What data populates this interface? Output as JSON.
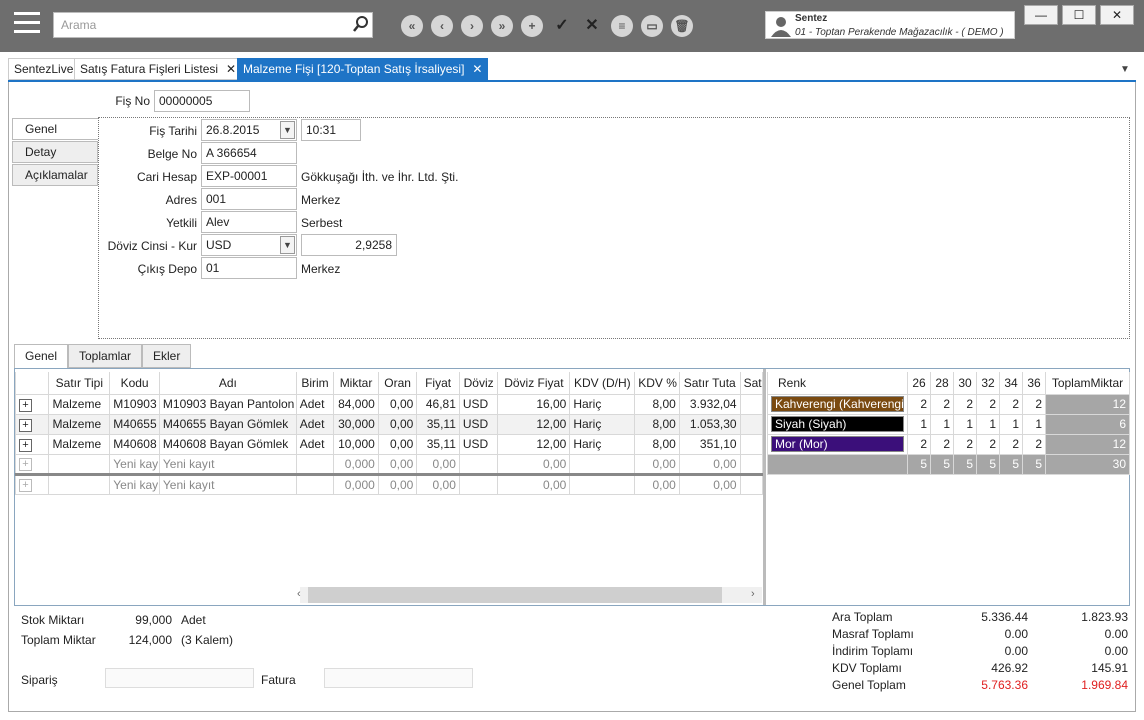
{
  "search": {
    "placeholder": "Arama"
  },
  "user": {
    "name": "Sentez",
    "company": "01 - Toptan Perakende Mağazacılık - ( DEMO )"
  },
  "tabs": [
    {
      "label": "SentezLive"
    },
    {
      "label": "Satış Fatura Fişleri Listesi"
    },
    {
      "label": "Malzeme Fişi  [120-Toptan Satış İrsaliyesi]"
    }
  ],
  "header": {
    "fis_no_label": "Fiş No",
    "fis_no": "00000005"
  },
  "side_tabs": [
    "Genel",
    "Detay",
    "Açıklamalar"
  ],
  "form": {
    "fis_tarihi_label": "Fiş Tarihi",
    "fis_tarihi": "26.8.2015",
    "saat": "10:31",
    "belge_no_label": "Belge No",
    "belge_no": "A 366654",
    "cari_label": "Cari Hesap",
    "cari": "EXP-00001",
    "cari_name": "Gökkuşağı İth. ve İhr. Ltd. Şti.",
    "adres_label": "Adres",
    "adres": "001",
    "adres_name": "Merkez",
    "yetkili_label": "Yetkili",
    "yetkili": "Alev",
    "yetkili_name": "Serbest",
    "doviz_label": "Döviz Cinsi - Kur",
    "doviz": "USD",
    "kur": "2,9258",
    "depo_label": "Çıkış Depo",
    "depo": "01",
    "depo_name": "Merkez"
  },
  "bottom_tabs": [
    "Genel",
    "Toplamlar",
    "Ekler"
  ],
  "grid": {
    "columns": [
      "Satır Tipi",
      "Kodu",
      "Adı",
      "Birim",
      "Miktar",
      "Oran",
      "Fiyat",
      "Döviz",
      "Döviz Fiyat",
      "KDV (D/H)",
      "KDV %",
      "Satır Tuta",
      "Satı"
    ],
    "rows": [
      [
        "Malzeme",
        "M10903",
        "M10903 Bayan Pantolon",
        "Adet",
        "84,000",
        "0,00",
        "46,81",
        "USD",
        "16,00",
        "Hariç",
        "8,00",
        "3.932,04"
      ],
      [
        "Malzeme",
        "M40655",
        "M40655 Bayan Gömlek",
        "Adet",
        "30,000",
        "0,00",
        "35,11",
        "USD",
        "12,00",
        "Hariç",
        "8,00",
        "1.053,30"
      ],
      [
        "Malzeme",
        "M40608",
        "M40608 Bayan Gömlek",
        "Adet",
        "10,000",
        "0,00",
        "35,11",
        "USD",
        "12,00",
        "Hariç",
        "8,00",
        "351,10"
      ]
    ],
    "new_rows": [
      [
        "",
        "Yeni kayı",
        "Yeni kayıt",
        "",
        "0,000",
        "0,00",
        "0,00",
        "",
        "0,00",
        "",
        "0,00",
        "0,00"
      ],
      [
        "",
        "Yeni kayı",
        "Yeni kayıt",
        "",
        "0,000",
        "0,00",
        "0,00",
        "",
        "0,00",
        "",
        "0,00",
        "0,00"
      ]
    ]
  },
  "color_grid": {
    "columns": [
      "Renk",
      "26",
      "28",
      "30",
      "32",
      "34",
      "36",
      "ToplamMiktar"
    ],
    "rows": [
      {
        "name": "Kahverengi (Kahverengi)",
        "color": "#7a4a10",
        "values": [
          "2",
          "2",
          "2",
          "2",
          "2",
          "2"
        ],
        "total": "12"
      },
      {
        "name": "Siyah (Siyah)",
        "color": "#000000",
        "values": [
          "1",
          "1",
          "1",
          "1",
          "1",
          "1"
        ],
        "total": "6"
      },
      {
        "name": "Mor (Mor)",
        "color": "#3b0f7a",
        "values": [
          "2",
          "2",
          "2",
          "2",
          "2",
          "2"
        ],
        "total": "12"
      }
    ],
    "totals": {
      "values": [
        "5",
        "5",
        "5",
        "5",
        "5",
        "5"
      ],
      "total": "30"
    }
  },
  "footer": {
    "stok_label": "Stok Miktarı",
    "stok": "99,000",
    "stok_unit": "Adet",
    "toplam_label": "Toplam Miktar",
    "toplam": "124,000",
    "toplam_note": "(3 Kalem)",
    "siparis_label": "Sipariş",
    "fatura_label": "Fatura"
  },
  "summary": [
    {
      "label": "Ara Toplam",
      "v1": "5.336.44",
      "v2": "1.823.93"
    },
    {
      "label": "Masraf Toplamı",
      "v1": "0.00",
      "v2": "0.00"
    },
    {
      "label": "İndirim Toplamı",
      "v1": "0.00",
      "v2": "0.00"
    },
    {
      "label": "KDV Toplamı",
      "v1": "426.92",
      "v2": "145.91"
    },
    {
      "label": "Genel Toplam",
      "v1": "5.763.36",
      "v2": "1.969.84",
      "highlight": "#e02020"
    }
  ]
}
